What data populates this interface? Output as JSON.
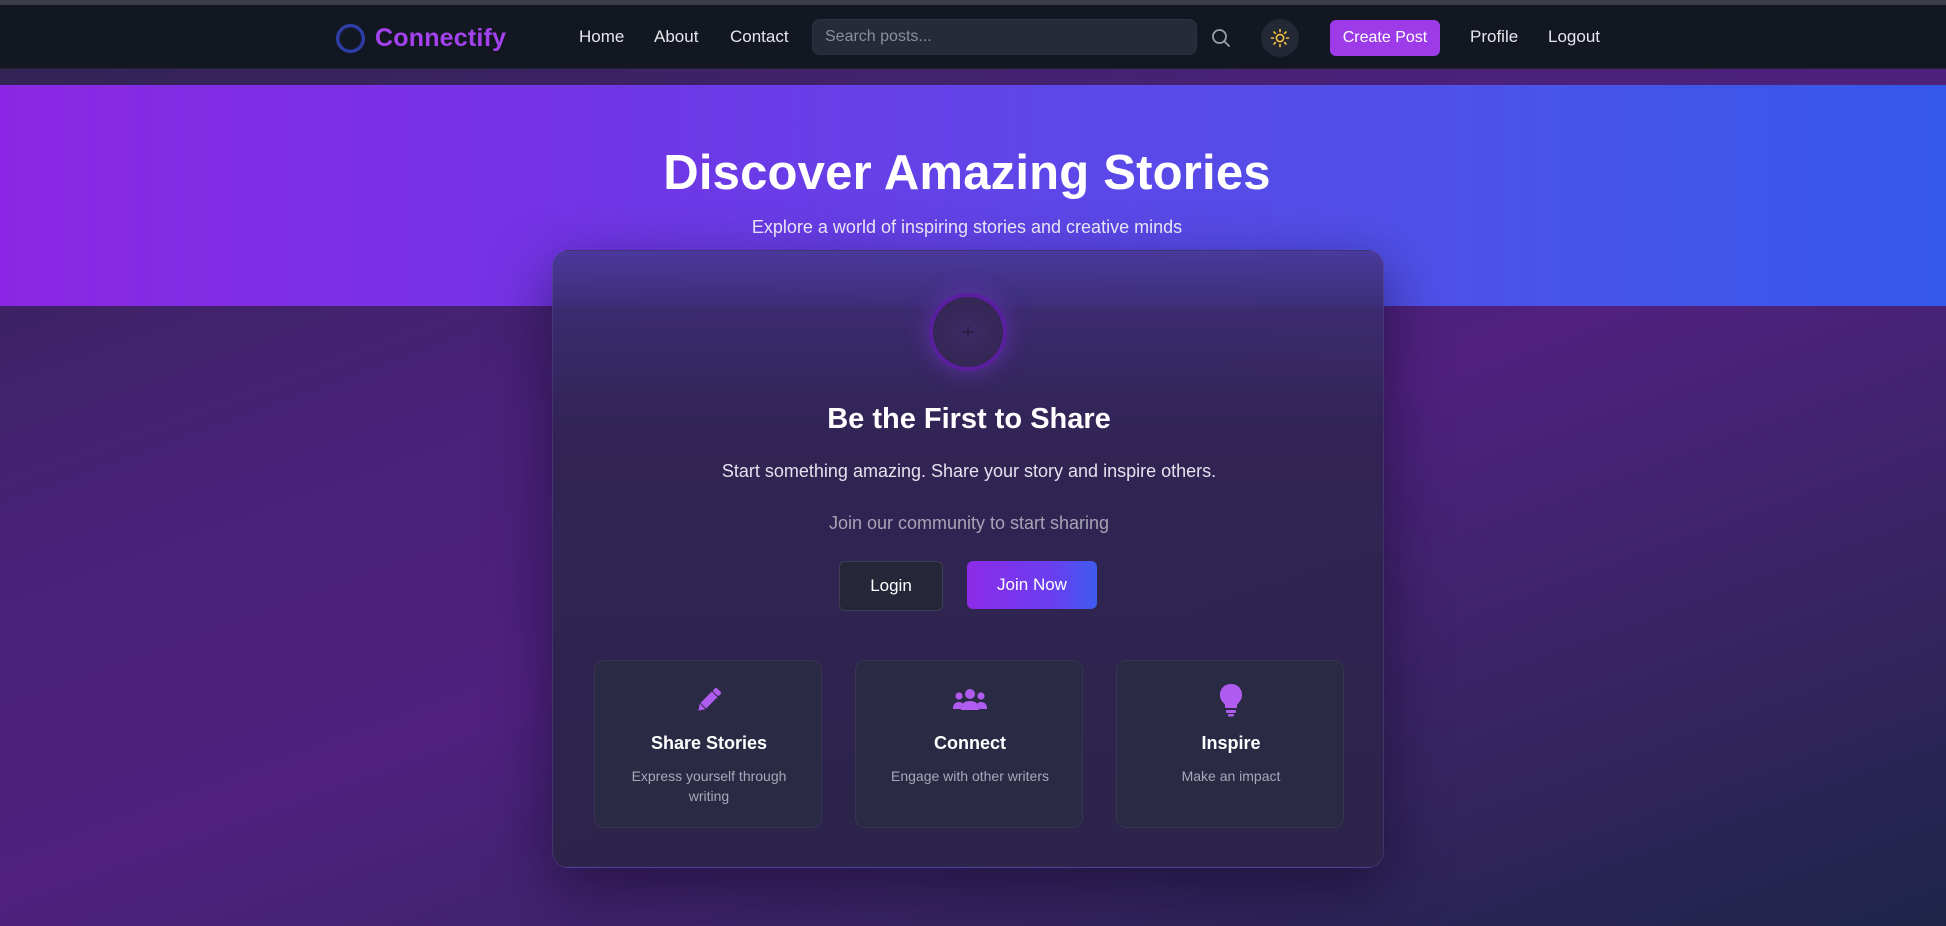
{
  "nav": {
    "brand": "Connectify",
    "links": [
      "Home",
      "About",
      "Contact"
    ],
    "search_placeholder": "Search posts...",
    "create_label": "Create Post",
    "profile_label": "Profile",
    "logout_label": "Logout",
    "brand_color": "#a442ef"
  },
  "hero": {
    "title": "Discover Amazing Stories",
    "subtitle": "Explore a world of inspiring stories and creative minds"
  },
  "card": {
    "title": "Be the First to Share",
    "description": "Start something amazing. Share your story and inspire others.",
    "join_text": "Join our community to start sharing",
    "login_label": "Login",
    "join_label": "Join Now",
    "features": [
      {
        "icon": "pencil-icon",
        "title": "Share Stories",
        "desc": "Express yourself through writing"
      },
      {
        "icon": "users-icon",
        "title": "Connect",
        "desc": "Engage with other writers"
      },
      {
        "icon": "lightbulb-icon",
        "title": "Inspire",
        "desc": "Make an impact"
      }
    ]
  },
  "colors": {
    "accent": "#9d3be8",
    "feature_icon": "#b05cf0",
    "sun_icon": "#f5c542"
  }
}
